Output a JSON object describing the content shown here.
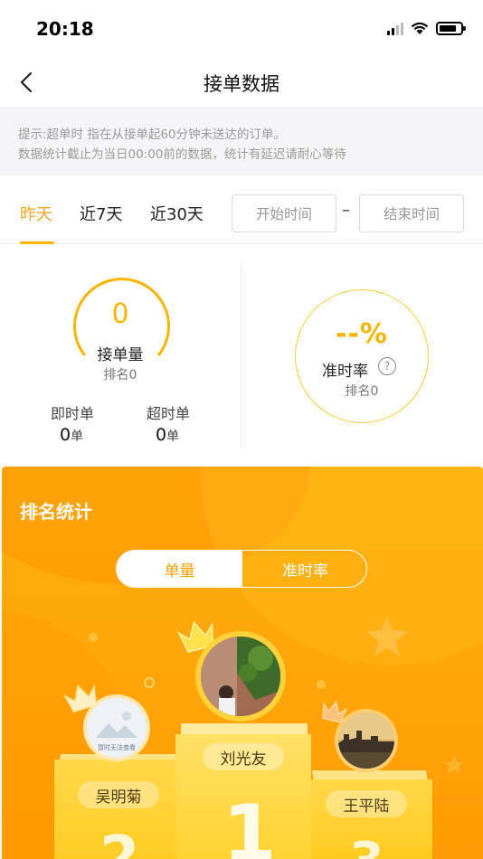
{
  "status_bar": {
    "time": "20:18"
  },
  "nav": {
    "title": "接单数据"
  },
  "notice": {
    "line1": "提示:超单时 指在从接单起60分钟未送达的订单。",
    "line2": "数据统计截止为当日00:00前的数据，统计有延迟请耐心等待"
  },
  "filters": {
    "tabs": [
      {
        "label": "昨天",
        "active": true
      },
      {
        "label": "近7天",
        "active": false
      },
      {
        "label": "近30天",
        "active": false
      }
    ],
    "start_placeholder": "开始时间",
    "separator": "–",
    "end_placeholder": "结束时间"
  },
  "stats": {
    "order_count": {
      "value": "0",
      "label": "接单量",
      "rank": "排名0"
    },
    "instant": {
      "label": "即时单",
      "value": "0",
      "unit": "单"
    },
    "overtime": {
      "label": "超时单",
      "value": "0",
      "unit": "单"
    },
    "ontime": {
      "value": "--%",
      "label": "准时率",
      "rank": "排名0"
    }
  },
  "ranking": {
    "title": "排名统计",
    "toggle": [
      {
        "label": "单量",
        "active": true
      },
      {
        "label": "准时率",
        "active": false
      }
    ],
    "podium": [
      {
        "rank": "1",
        "name": "刘光友"
      },
      {
        "rank": "2",
        "name": "吴明菊",
        "avatar_text": "暂时无法查看"
      },
      {
        "rank": "3",
        "name": "王平陆"
      }
    ]
  },
  "colors": {
    "accent": "#f7b500",
    "ranking_bg": "#ffa50a"
  }
}
